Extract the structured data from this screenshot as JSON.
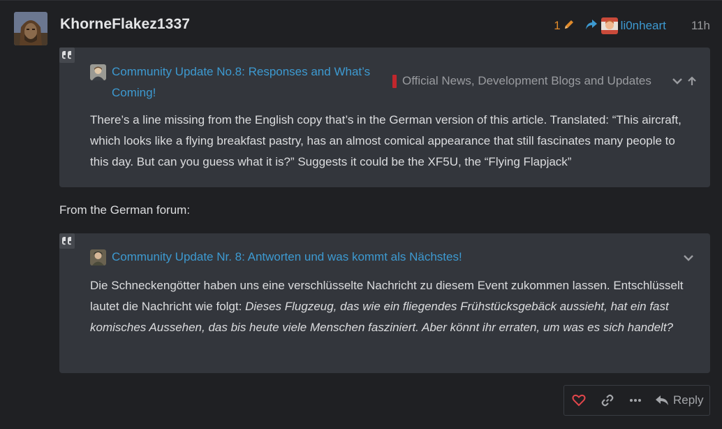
{
  "post": {
    "author": "KhorneFlakez1337",
    "edit_count": "1",
    "reply_to_user": "li0nheart",
    "age": "11h",
    "between_text": "From the German forum:",
    "actions": {
      "reply_label": "Reply"
    }
  },
  "quote1": {
    "title_line1": "Community Update No.8: Responses and What’s",
    "title_line2": "Coming!",
    "category": "Official News, Development Blogs and Updates",
    "category_color": "#c1272d",
    "body": "There’s a line missing from the English copy that’s in the German version of this article. Translated: “This aircraft, which looks like a flying breakfast pastry, has an almost comical appearance that still fascinates many people to this day. But can you guess what it is?” Suggests it could be the XF5U, the “Flying Flapjack”"
  },
  "quote2": {
    "title": "Community Update Nr. 8: Antworten und was kommt als Nächstes!",
    "body_plain": "Die Schneckengötter haben uns eine verschlüsselte Nachricht zu diesem Event zukommen lassen. Entschlüsselt lautet die Nachricht wie folgt: ",
    "body_italic": "Dieses Flugzeug, das wie ein fliegendes Frühstücksgebäck aussieht, hat ein fast komisches Aussehen, das bis heute viele Menschen fasziniert. Aber könnt ihr erraten, um was es sich handelt?"
  },
  "colors": {
    "accent": "#3d9ad1",
    "edit": "#e08a2b",
    "like": "#e0464b"
  }
}
